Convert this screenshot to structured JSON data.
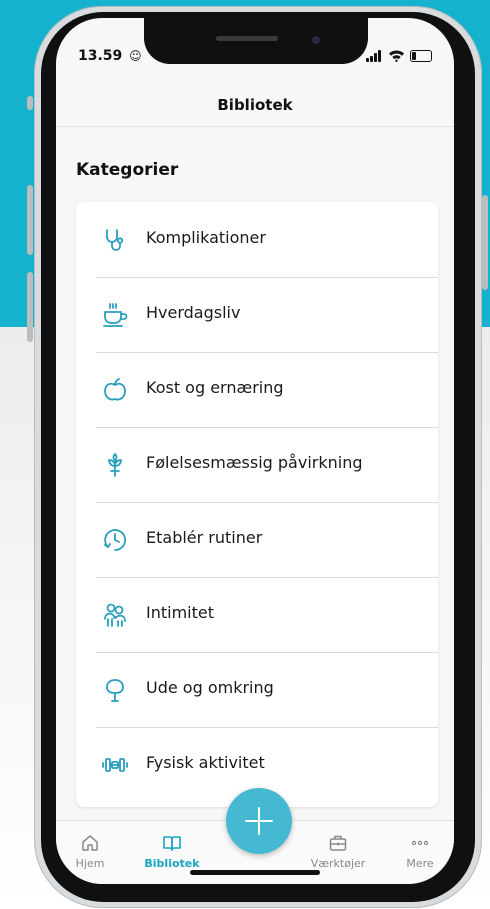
{
  "status_bar": {
    "time": "13.59",
    "face_glyph": "☺"
  },
  "header": {
    "title": "Bibliotek"
  },
  "section": {
    "title": "Kategorier"
  },
  "categories": [
    {
      "label": "Komplikationer",
      "icon": "stethoscope-icon"
    },
    {
      "label": "Hverdagsliv",
      "icon": "coffee-cup-icon"
    },
    {
      "label": "Kost og ernæring",
      "icon": "apple-icon"
    },
    {
      "label": "Følelsesmæssig påvirkning",
      "icon": "plant-icon"
    },
    {
      "label": "Etablér rutiner",
      "icon": "clock-icon"
    },
    {
      "label": "Intimitet",
      "icon": "people-icon"
    },
    {
      "label": "Ude og omkring",
      "icon": "tree-icon"
    },
    {
      "label": "Fysisk aktivitet",
      "icon": "dumbbell-icon"
    }
  ],
  "tab_bar": {
    "items": [
      {
        "label": "Hjem",
        "icon": "home-icon",
        "active": false
      },
      {
        "label": "Bibliotek",
        "icon": "book-icon",
        "active": true
      },
      {
        "label": "Værktøjer",
        "icon": "toolbox-icon",
        "active": false
      },
      {
        "label": "Mere",
        "icon": "more-icon",
        "active": false
      }
    ],
    "fab_icon": "plus-icon"
  },
  "colors": {
    "accent": "#1aa4c2",
    "fab": "#45b9d2",
    "background_top": "#14b2cc",
    "icon": "#2a9fbe"
  }
}
